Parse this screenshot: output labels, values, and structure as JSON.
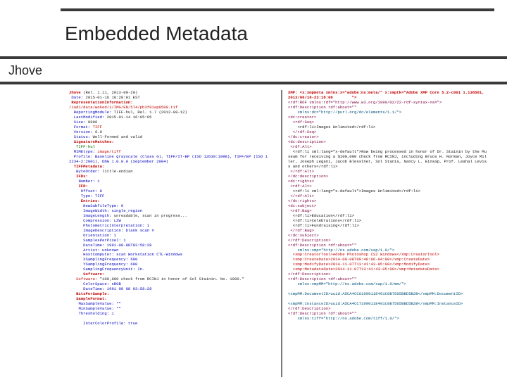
{
  "slide": {
    "title": "Embedded Metadata",
    "subtitle": "Jhove"
  },
  "jhove_left": {
    "jhove_rel": "(Rel. 1.11, 2013-09-29)",
    "date": "2015-01-16 18:28:01 EST",
    "rep_info": "RepresentationInformation:",
    "uri": "/iad1/data/woked/1/IMG/EN/574/pb3f91ap9509.tif",
    "reporting_module": "TIFF-hul, Rel. 1.7 (2012-08-12)",
    "last_modified": "2015-01-14 16:05:05",
    "size": "8000",
    "format": "TIFF",
    "version": "6.0",
    "status": "Well-Formed and valid",
    "sig_matches": "SignatureMatches:",
    "sig": "TIFF-hul",
    "mime": "image/tiff",
    "profile": "Profile: Baseline grayscale (Class G), TIFF/IT-BP (ISO 12639:1998), TIFF/EP (ISO 12234-2:2001), DNG 1.0.0.0 (September 2004)",
    "tiff_meta": "TIFFMetadata:",
    "byte_order": "little-endian",
    "IFDs_n": "IFDs:",
    "n": "Number: 1",
    "IFDh": "IFD:",
    "offset": "Offset: 8",
    "type": "Type: TIFF",
    "entries": "Entries:",
    "new_subfile": "NewSubfileType: 0",
    "image_width": "ImageWidth: single_region",
    "image_length": "unreadable, scan in progress...",
    "compression": "Compression: LZW",
    "photo_interp": "PhotometricInterpretation: 1",
    "image_description": "ImageDescription: blank scan #",
    "orientation": "Orientation: 1",
    "samples_per_pixel": "SamplesPerPixel: 1",
    "datetime": "DateTime: 1991-08-08T03:58:28",
    "artist": "Artist: unknown",
    "host_computer": "HostComputer: scan Workstation CTL-Windows",
    "xres": "XSamplingFrequency: 600",
    "yres": "YSamplingFrequency: 600",
    "res_unit": "SamplingFrequencyUnit: In.",
    "software_h": "Software:",
    "software": "\"100,000 check from RCINJ in honor of Sol Stainin. No. 1900.\"",
    "color_space": "ColorSpace: sRGB",
    "datetime2": "DateTime: 1991 08 08 03:58:28",
    "bits": "BitsPerSample:",
    "sample_fmt": "SampleFormat:",
    "maxsv": "MaxSampleValue: \"\"",
    "minsv": "MinSampleValue: \"\"",
    "threshold": "Thresholding: 1",
    "interc": "InterColorProfile: true"
  },
  "xmp_right": {
    "header": "XMP: <x:xmpmeta xmlns:x=\"adobe:ns:meta/\" x:xmptk=\"Adobe XMP Core 5.2-c001 1.136581, 2012/06/18-23:18:06        \">",
    "rdf_open": "<rdf:RDF xmlns:rdf=\"http://www.w3.org/1999/02/22-rdf-syntax-ns#\">",
    "desc1_open": "<rdf:Description rdf:about=\"\"",
    "xmlns_dc": "    xmlns:dc=\"http://purl.org/dc/elements/1.1/\">",
    "dc_creator_open": "<dc:creator>",
    "seq_open": "  <rdf:Seq>",
    "creator_li": "    <rdf:li>Images Unlimited</rdf:li>",
    "seq_close": "  </rdf:Seq>",
    "dc_creator_close": "</dc:creator>",
    "dc_desc_open": "<dc:description>",
    "alt_open": " <rdf:Alt>",
    "desc_li": "  <rdf:li xml:lang=\"x-default\">Now being processed in honor of Dr. Stainin by the Museum for receiving a $100,000 check from RCINJ, including Bruce H. Norman, Joyce Miller, Joseph Legani, Jacob Blesstner, Sol Stanis, Nancy L. Einsap, Prof. Leahal Leviss and others</rdf:li>",
    "alt_close": " </rdf:Alt>",
    "dc_desc_close": "</dc:description>",
    "dc_rights_open": "<dc:rights>",
    "alt2o": " <rdf:Alt>",
    "rights_li": "  <rdf:li xml:lang=\"x-default\">Images Unlimited</rdf:li>",
    "alt2c": " </rdf:Alt>",
    "dc_rights_close": "</dc:rights>",
    "dc_subject_open": "<dc:subject>",
    "bag_open": " <rdf:Bag>",
    "bag_li1": "  <rdf:li>Education</rdf:li>",
    "bag_li2": "  <rdf:li>Celebrations</rdf:li>",
    "bag_li3": "  <rdf:li>Fundraising</rdf:li>",
    "bag_close": " </rdf:Bag>",
    "dc_subject_close": "</dc:subject>",
    "desc1_close": "</rdf:Description>",
    "desc2_open": "<rdf:Description rdf:about=\"\"",
    "xmlns_xmp": "    xmlns:xmp=\"http://ns.adobe.com/xap/1.0/\">",
    "creator_tool": "  <xmp:CreatorTool>Adobe Photoshop CS2 Windows</xmp:CreatorTool>",
    "create_date": "  <xmp:CreateDate>2014-09-08T09:48:06-04:00</xmp:CreateDate>",
    "modify_date": "  <xmp:ModifyDate>2014-11-07T13:41:43-05:00</xmp:ModifyDate>",
    "meta_date": "  <xmp:MetadataDate>2014-11-07T13:41:43-05:00</xmp:MetadataDate>",
    "desc2_close": "</rdf:Description>",
    "desc3_open": "<rdf:Description rdf:about=\"\"",
    "xmlns_mm": "    xmlns:xmpMM=\"http://ns.adobe.com/xap/1.0/mm/\">",
    "docid": "<xmpMM:DocumentID>uuid:A5CA4CC6109011E491C0B7505BBD5B2B</xmpMM:DocumentID>",
    "instid": "<xmpMM:InstanceID>uuid:A5CA4CC7109011E491C0B7505BBD5B2B</xmpMM:InstanceID>",
    "desc3_close": "</rdf:Description>",
    "desc4_open": "<rdf:Description rdf:about=\"\"",
    "xmlns_tiff": "    xmlns:tiff=\"http://ns.adobe.com/tiff/1.0/\">"
  }
}
